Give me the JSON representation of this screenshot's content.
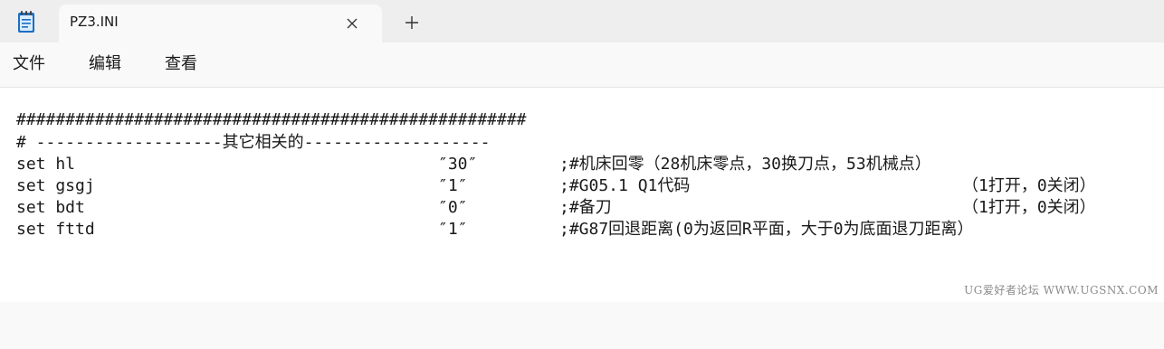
{
  "window": {
    "tab_title": "PZ3.INI",
    "icons": {
      "app": "notepad-icon",
      "close": "close-icon",
      "new_tab": "plus-icon"
    }
  },
  "menu": {
    "file": "文件",
    "edit": "编辑",
    "view": "查看"
  },
  "editor": {
    "hash_line": "####################################################",
    "section_line": "# -------------------其它相关的-------------------",
    "settings": [
      {
        "key": "set hl",
        "value": "″30″",
        "comment": ";#机床回零（28机床零点，30换刀点，53机械点）",
        "extra": ""
      },
      {
        "key": "set gsgj",
        "value": "″1″",
        "comment": ";#G05.1 Q1代码",
        "extra": "（1打开，0关闭）"
      },
      {
        "key": "set bdt",
        "value": "″0″",
        "comment": ";#备刀",
        "extra": "（1打开，0关闭）"
      },
      {
        "key": "set fttd",
        "value": "″1″",
        "comment": ";#G87回退距离(0为返回R平面，大于0为底面退刀距离）",
        "extra": ""
      }
    ]
  },
  "watermark": "UG爱好者论坛 WWW.UGSNX.COM",
  "colors": {
    "titlebar": "#eeeeee",
    "surface": "#f9f9f9",
    "editor": "#ffffff",
    "text": "#1a1a1a",
    "icon_blue": "#1b6ec2"
  }
}
